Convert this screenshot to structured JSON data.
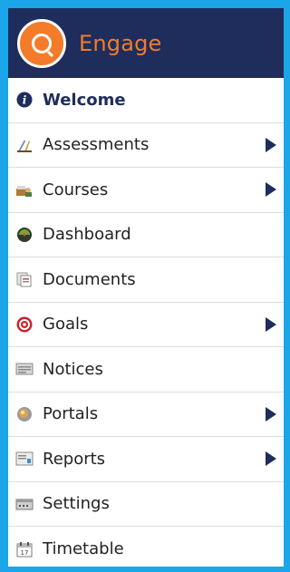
{
  "brand": {
    "name": "Engage"
  },
  "menu": {
    "items": [
      {
        "label": "Welcome",
        "icon": "info-icon",
        "active": true,
        "has_submenu": false
      },
      {
        "label": "Assessments",
        "icon": "assessments-icon",
        "active": false,
        "has_submenu": true
      },
      {
        "label": "Courses",
        "icon": "courses-icon",
        "active": false,
        "has_submenu": true
      },
      {
        "label": "Dashboard",
        "icon": "dashboard-icon",
        "active": false,
        "has_submenu": false
      },
      {
        "label": "Documents",
        "icon": "documents-icon",
        "active": false,
        "has_submenu": false
      },
      {
        "label": "Goals",
        "icon": "target-icon",
        "active": false,
        "has_submenu": true
      },
      {
        "label": "Notices",
        "icon": "notices-icon",
        "active": false,
        "has_submenu": false
      },
      {
        "label": "Portals",
        "icon": "portals-icon",
        "active": false,
        "has_submenu": true
      },
      {
        "label": "Reports",
        "icon": "reports-icon",
        "active": false,
        "has_submenu": true
      },
      {
        "label": "Settings",
        "icon": "settings-icon",
        "active": false,
        "has_submenu": false
      },
      {
        "label": "Timetable",
        "icon": "calendar-icon",
        "active": false,
        "has_submenu": false
      }
    ]
  },
  "colors": {
    "background": "#1aa6e9",
    "header": "#1f2d5c",
    "brand_accent": "#f47b2a",
    "active_text": "#1f2d5c"
  }
}
